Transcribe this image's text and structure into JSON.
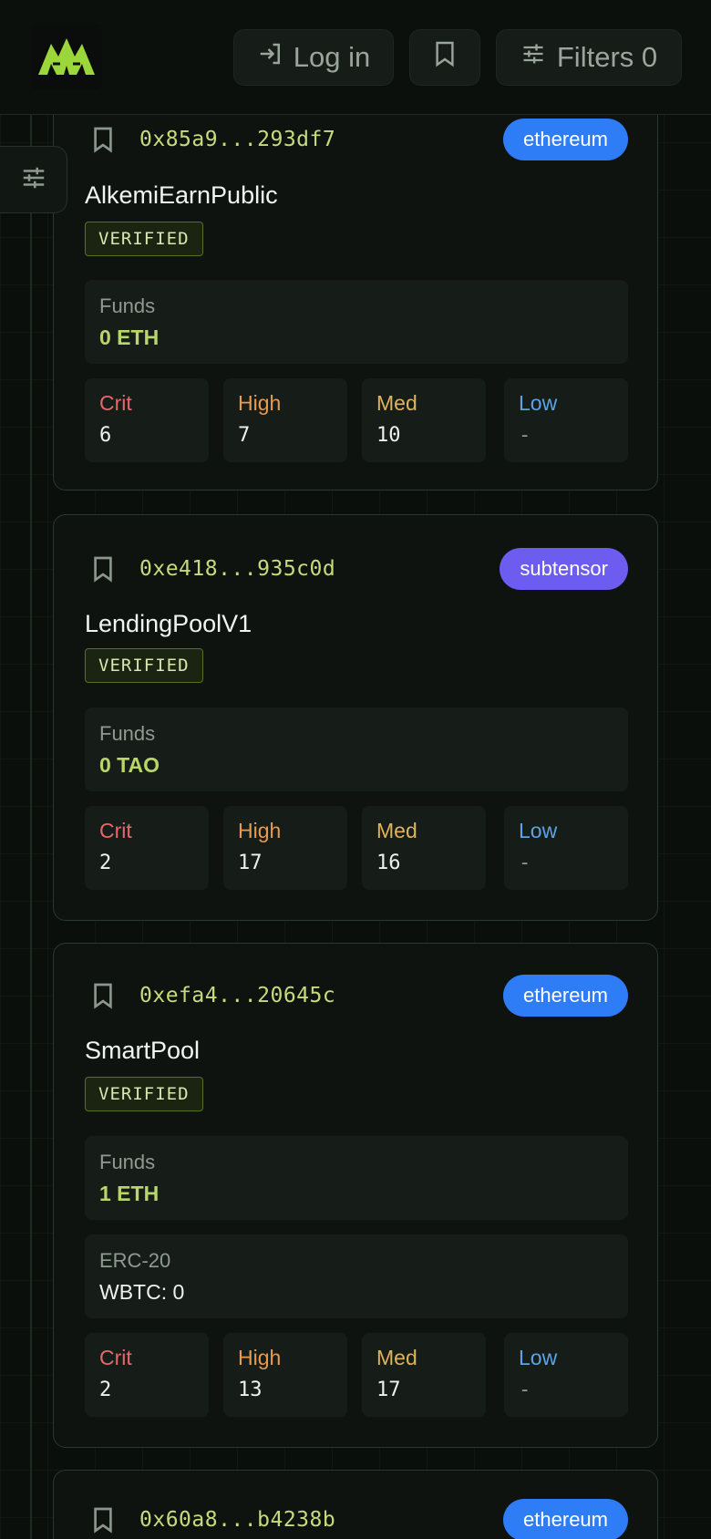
{
  "header": {
    "login_label": "Log in",
    "filters_label": "Filters 0"
  },
  "colors": {
    "accent": "#c6dc7c",
    "ethereum_badge": "#2f7df6",
    "subtensor_badge": "#6c5cf0",
    "crit": "#e7676a",
    "high": "#e89a4d",
    "med": "#e0b359",
    "low": "#5ea2e6"
  },
  "icons": {
    "logo": "logo-icon",
    "login": "login-arrow-icon",
    "bookmark": "bookmark-icon",
    "filters": "sliders-icon"
  },
  "severity_labels": {
    "crit": "Crit",
    "high": "High",
    "med": "Med",
    "low": "Low"
  },
  "contracts": [
    {
      "address": "0x85a9...293df7",
      "chain": "ethereum",
      "name": "AlkemiEarnPublic",
      "status": "VERIFIED",
      "funds_label": "Funds",
      "funds": "0 ETH",
      "severity": {
        "crit": "6",
        "high": "7",
        "med": "10",
        "low": "-"
      }
    },
    {
      "address": "0xe418...935c0d",
      "chain": "subtensor",
      "name": "LendingPoolV1",
      "status": "VERIFIED",
      "funds_label": "Funds",
      "funds": "0 TAO",
      "severity": {
        "crit": "2",
        "high": "17",
        "med": "16",
        "low": "-"
      }
    },
    {
      "address": "0xefa4...20645c",
      "chain": "ethereum",
      "name": "SmartPool",
      "status": "VERIFIED",
      "funds_label": "Funds",
      "funds": "1 ETH",
      "erc20_label": "ERC-20",
      "erc20": "WBTC: 0",
      "severity": {
        "crit": "2",
        "high": "13",
        "med": "17",
        "low": "-"
      }
    },
    {
      "address": "0x60a8...b4238b",
      "chain": "ethereum"
    }
  ]
}
